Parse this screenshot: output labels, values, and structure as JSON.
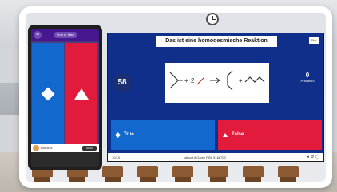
{
  "phone": {
    "menu_icon": "hamburger-icon",
    "pill_label": "True or false",
    "answer_left_icon": "diamond-icon",
    "answer_right_icon": "triangle-icon",
    "player_name": "Dominik",
    "player_score": "0000"
  },
  "screen": {
    "question": "Das ist eine homodesmische Reaktion",
    "skip_label": "Skip",
    "timer": "58",
    "answers_count": "0",
    "answers_label": "Answers",
    "choices": [
      {
        "label": "True",
        "icon": "diamond-icon",
        "color": "#1368ce"
      },
      {
        "label": "False",
        "icon": "triangle-icon",
        "color": "#e21b3c"
      }
    ],
    "question_count": "10/10",
    "game_info": "kahoot.it  Game PIN: 5168703"
  },
  "colors": {
    "kahoot_purple": "#46178f",
    "blue": "#1368ce",
    "red": "#e21b3c",
    "screen_bg": "#0f2f8a"
  }
}
